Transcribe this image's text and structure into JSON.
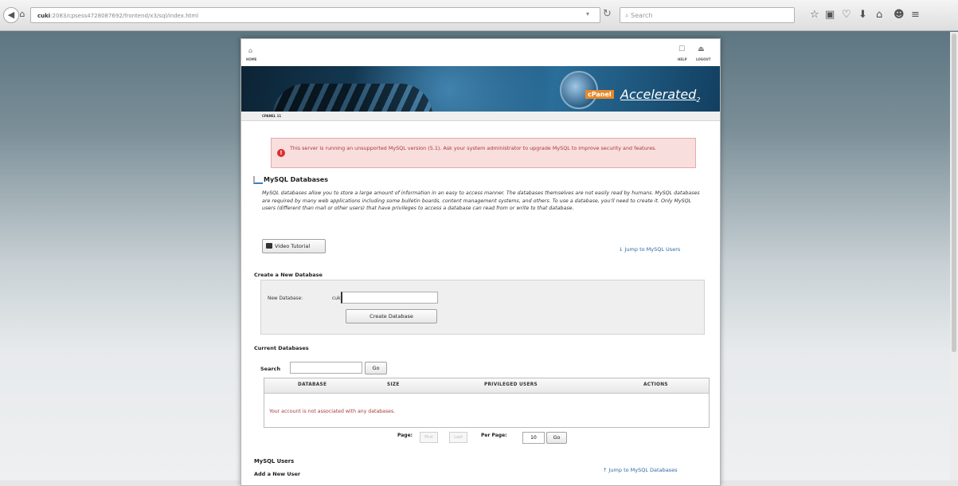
{
  "browser": {
    "url_host": "cuki",
    "url_rest": ":2083/cpsess4728087692/frontend/x3/sql/index.html",
    "search_placeholder": "Search",
    "toolbar_icons": [
      "star-icon",
      "reader-icon",
      "pocket-icon",
      "download-icon",
      "home-icon",
      "smiley-icon",
      "menu-icon"
    ]
  },
  "cpanel": {
    "topbar": {
      "home": "HOME",
      "help": "HELP",
      "logout": "LOGOUT"
    },
    "logo": {
      "brand": "cPanel",
      "accelerated": "Accelerated",
      "subscript": "2"
    },
    "breadcrumb": "CPANEL 11",
    "alert": "This server is running an unsupported MySQL version (5.1). Ask your system administrator to upgrade MySQL to improve security and features.",
    "section_title": "MySQL Databases",
    "description": "MySQL databases allow you to store a large amount of information in an easy to access manner. The databases themselves are not easily read by humans. MySQL databases are required by many web applications including some bulletin boards, content management systems, and others. To use a database, you'll need to create it. Only MySQL users (different than mail or other users) that have privileges to access a database can read from or write to that database.",
    "video_tutorial": "Video Tutorial",
    "jump_users": "↓ Jump to MySQL Users",
    "create_heading": "Create a New Database",
    "new_db_label": "New Database:",
    "new_db_prefix": "cuki_",
    "new_db_value": "",
    "create_button": "Create Database",
    "current_heading": "Current Databases",
    "search_label": "Search",
    "search_value": "",
    "go_button": "Go",
    "table": {
      "columns": [
        "Database",
        "Size",
        "Privileged Users",
        "Actions"
      ],
      "empty_message": "Your account is not associated with any databases."
    },
    "pager": {
      "page_label": "Page:",
      "first": "First",
      "last": "Last",
      "per_page_label": "Per Page:",
      "per_page_value": "10",
      "go": "Go"
    },
    "users_heading": "MySQL Users",
    "jump_databases": "↑ Jump to MySQL Databases",
    "add_user_heading": "Add a New User"
  }
}
